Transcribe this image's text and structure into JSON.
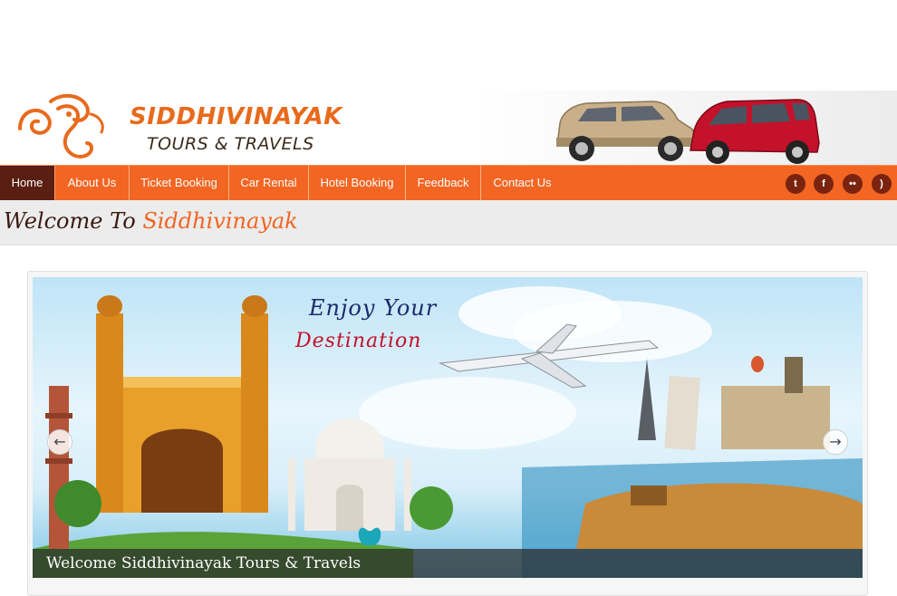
{
  "brand": {
    "name": "SIDDHIVINAYAK",
    "tagline": "TOURS & TRAVELS"
  },
  "nav": {
    "items": [
      {
        "label": "Home",
        "active": true
      },
      {
        "label": "About Us",
        "active": false
      },
      {
        "label": "Ticket Booking",
        "active": false
      },
      {
        "label": "Car Rental",
        "active": false
      },
      {
        "label": "Hotel Booking",
        "active": false
      },
      {
        "label": "Feedback",
        "active": false
      },
      {
        "label": "Contact Us",
        "active": false
      }
    ],
    "social_icons": [
      "twitter-icon",
      "facebook-icon",
      "flickr-icon",
      "rss-icon"
    ]
  },
  "welcome": {
    "part1": "Welcome To",
    "part2": "Siddhivinayak"
  },
  "slider": {
    "headline_1": "Enjoy Your",
    "headline_2": "Destination",
    "caption": "Welcome Siddhivinayak Tours & Travels",
    "prev_icon": "arrow-left-icon",
    "next_icon": "arrow-right-icon"
  },
  "colors": {
    "accent": "#f26522",
    "nav_active": "#5a1e12",
    "welcome_dark": "#3b1a10"
  }
}
